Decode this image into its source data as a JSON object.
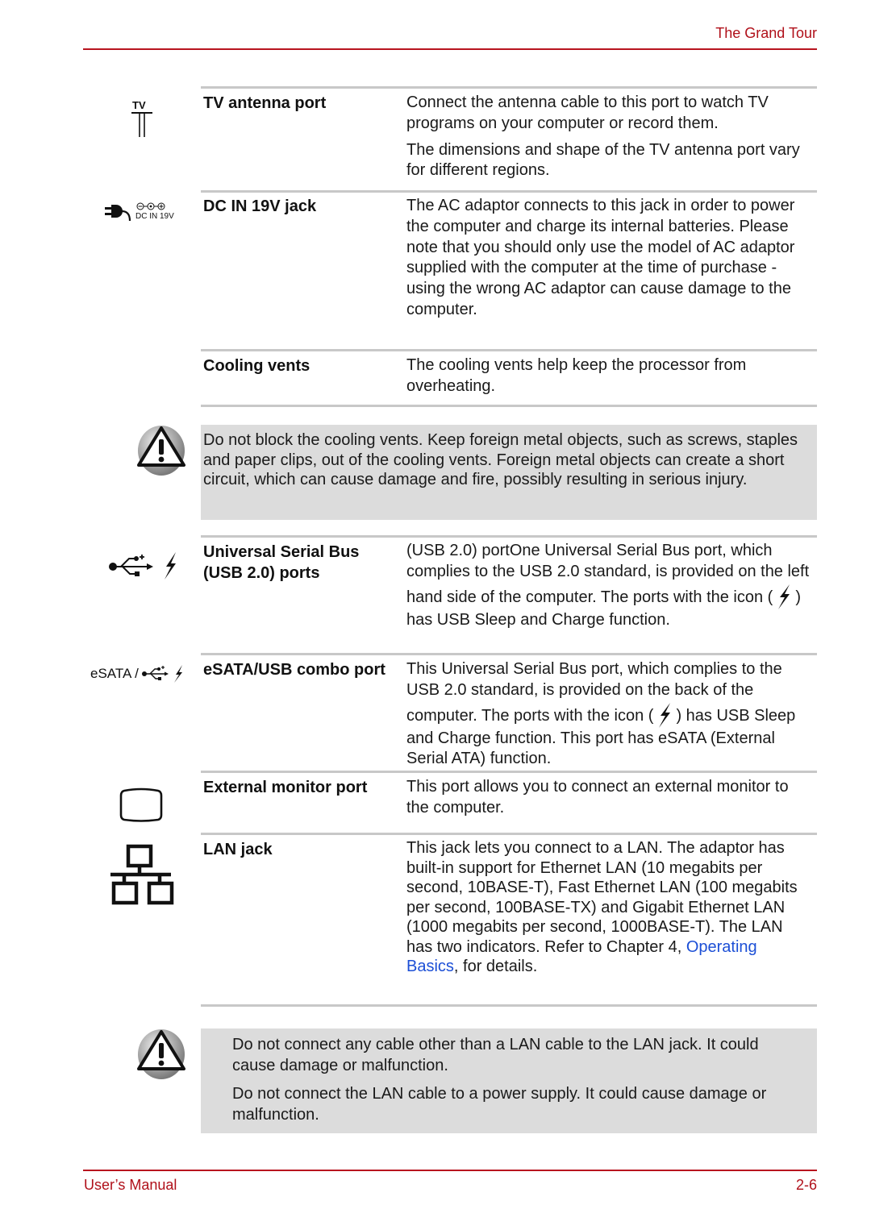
{
  "header": {
    "section_title": "The Grand Tour"
  },
  "footer": {
    "manual_label": "User’s Manual",
    "page_number": "2-6"
  },
  "colors": {
    "accent_red": "#b8141f",
    "link_blue": "#1c4fd6",
    "warning_bg": "#dcdcdc",
    "rule_gray": "#c8c8c8"
  },
  "rows": [
    {
      "icon": "tv-antenna-icon",
      "icon_label": "TV",
      "term": "TV antenna port",
      "desc": [
        "Connect the antenna cable to this port to watch TV programs on your computer or record them.",
        "The dimensions and shape of the TV antenna port vary for different regions."
      ]
    },
    {
      "icon": "dc-in-icon",
      "icon_label": "DC IN 19V",
      "term": "DC IN 19V jack",
      "desc": [
        "The AC adaptor connects to this jack in order to power the computer and charge its internal batteries. Please note that you should only use the model of AC adaptor supplied with the computer at the time of purchase - using the wrong AC adaptor can cause damage to the computer."
      ]
    },
    {
      "icon": "",
      "term": "Cooling vents",
      "desc": [
        "The cooling vents help keep the processor from overheating."
      ]
    },
    {
      "icon": "usb-sleep-charge-icon",
      "term": "Universal Serial Bus (USB 2.0) ports",
      "desc_parts": {
        "before_icon": "(USB 2.0) portOne Universal Serial Bus port, which complies to the USB 2.0 standard, is provided on the left hand side of the computer. The ports with the icon (",
        "after_icon": ") has USB Sleep and Charge function."
      }
    },
    {
      "icon": "esata-usb-icon",
      "icon_label": "eSATA /",
      "term": "eSATA/USB combo port",
      "desc_parts": {
        "before_icon": "This Universal Serial Bus port, which complies to the USB 2.0 standard, is provided on the back of the computer. The ports with the icon (",
        "after_icon": ") has USB Sleep and Charge function. This port has eSATA (External Serial ATA) function."
      }
    },
    {
      "icon": "external-monitor-icon",
      "term": "External monitor port",
      "desc": [
        "This port allows you to connect an external monitor to the computer."
      ]
    },
    {
      "icon": "lan-icon",
      "term": "LAN jack",
      "desc_parts": {
        "before_link": "This jack lets you connect to a LAN. The adaptor has built-in support for Ethernet LAN (10 megabits per second, 10BASE-T), Fast Ethernet LAN (100 megabits per second, 100BASE-TX) and Gigabit Ethernet LAN (1000 megabits per second, 1000BASE-T). The LAN has two indicators. Refer to Chapter 4, ",
        "link": "Operating Basics",
        "after_link": ", for details."
      }
    }
  ],
  "warnings": [
    {
      "icon": "warning-icon",
      "paragraphs": [
        "Do not block the cooling vents. Keep foreign metal objects, such as screws, staples and paper clips, out of the cooling vents. Foreign metal objects can create a short circuit, which can cause damage and fire, possibly resulting in serious injury."
      ]
    },
    {
      "icon": "warning-icon",
      "paragraphs": [
        "Do not connect any cable other than a LAN cable to the LAN jack. It could cause damage or malfunction.",
        "Do not connect the LAN cable to a power supply. It could cause damage or malfunction."
      ]
    }
  ]
}
